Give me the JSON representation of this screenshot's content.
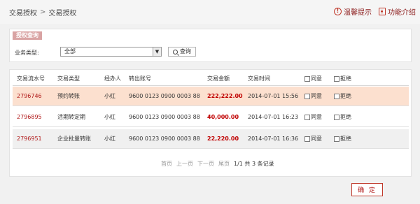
{
  "breadcrumb": {
    "parent": "交易授权",
    "separator": ">",
    "current": "交易授权"
  },
  "top_links": {
    "tips": "温馨提示",
    "help": "功能介绍"
  },
  "query": {
    "tag": "授权查询",
    "filter_label": "业务类型:",
    "filter_value": "全部",
    "query_button": "查询"
  },
  "table": {
    "headers": {
      "serial": "交易流水号",
      "type": "交易类型",
      "handler": "经办人",
      "account": "转出账号",
      "amount": "交易金额",
      "time": "交易时间",
      "agree": "同意",
      "reject": "拒绝"
    },
    "rows": [
      {
        "serial": "2796746",
        "type": "预约转账",
        "handler": "小红",
        "account": "9600 0123 0900 0003 88",
        "amount": "222,222.00",
        "time": "2014-07-01 15:56",
        "agree": "同意",
        "reject": "拒绝"
      },
      {
        "serial": "2796895",
        "type": "活期转定期",
        "handler": "小红",
        "account": "9600 0123 0900 0003 88",
        "amount": "40,000.00",
        "time": "2014-07-01 16:23",
        "agree": "同意",
        "reject": "拒绝"
      },
      {
        "serial": "2796951",
        "type": "企业批量转账",
        "handler": "小红",
        "account": "9600 0123 0900 0003 88",
        "amount": "22,220.00",
        "time": "2014-07-01 16:36",
        "agree": "同意",
        "reject": "拒绝"
      }
    ]
  },
  "pagination": {
    "first": "首页",
    "prev": "上一页",
    "next": "下一页",
    "last": "尾页",
    "info": "1/1 共 3 条记录"
  },
  "confirm_button": "确 定"
}
